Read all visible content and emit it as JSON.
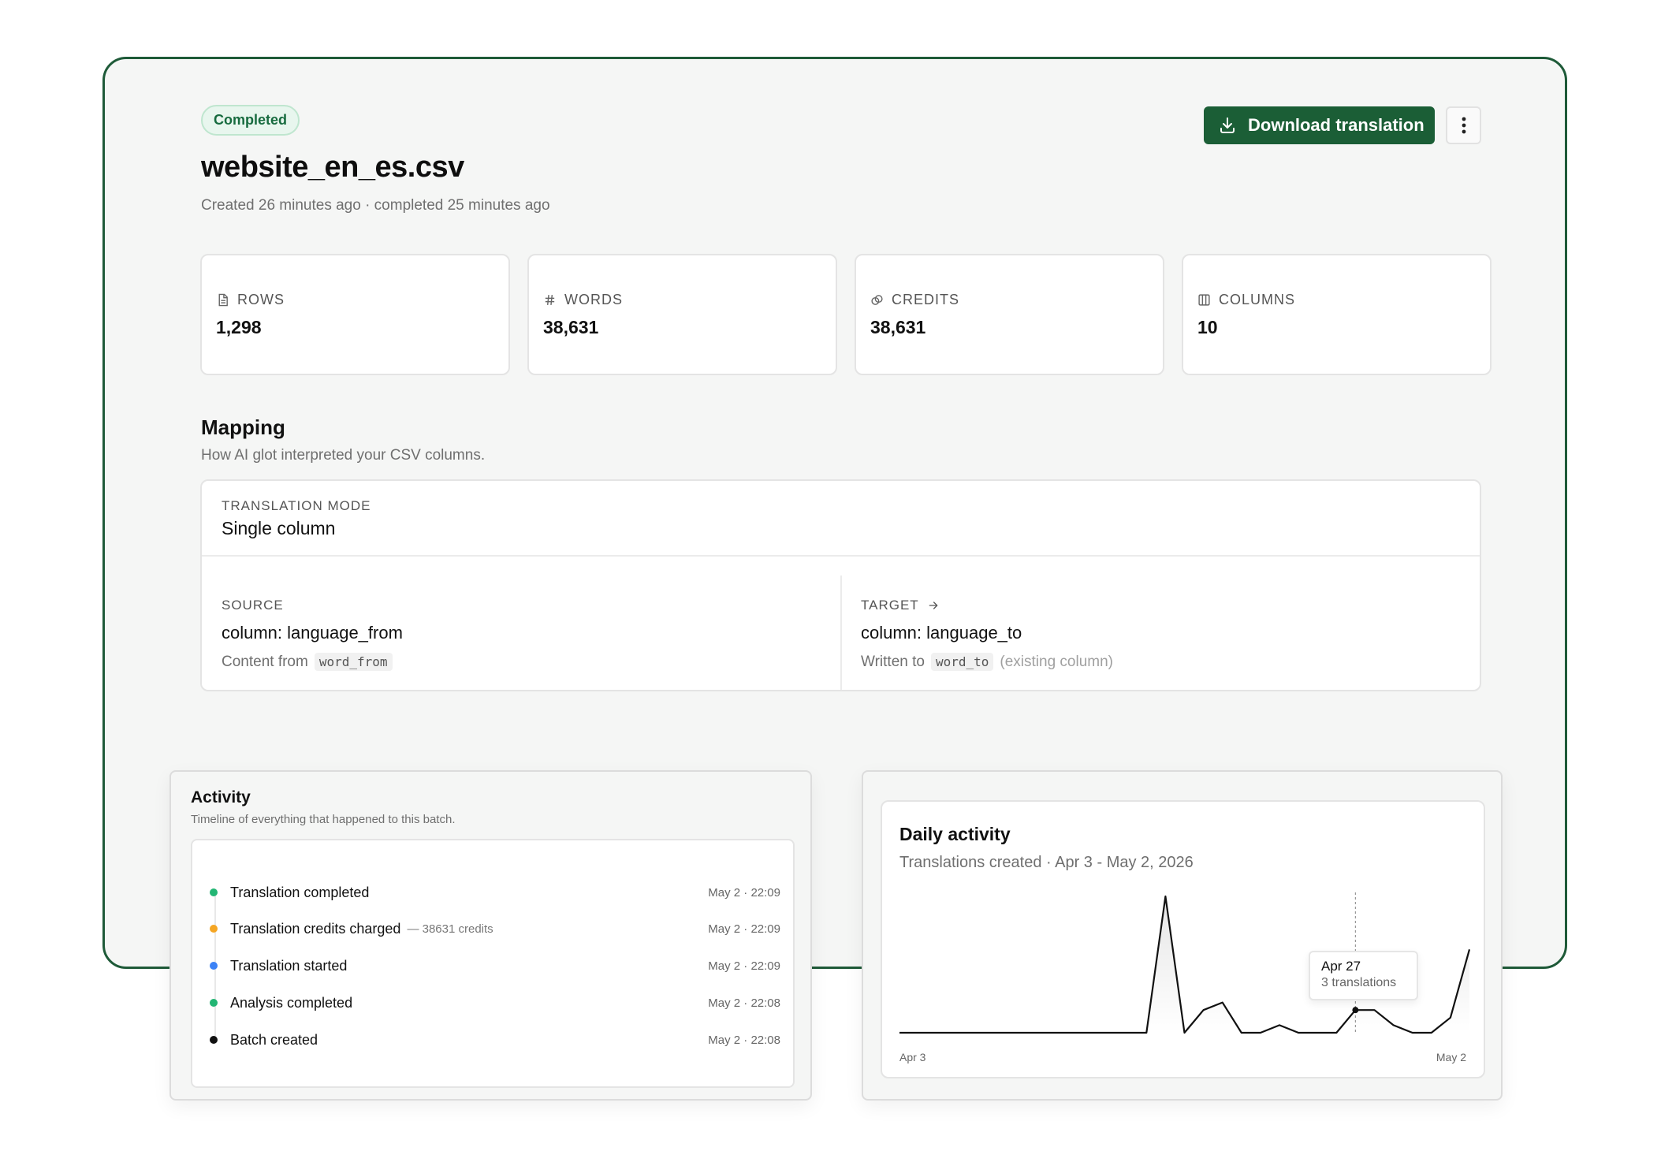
{
  "batch": {
    "status": "Completed",
    "filename": "website_en_es.csv",
    "meta": "Created 26 minutes ago · completed 25 minutes ago",
    "download_label": "Download translation"
  },
  "stats": [
    {
      "label": "ROWS",
      "value": "1,298",
      "icon": "file-icon"
    },
    {
      "label": "WORDS",
      "value": "38,631",
      "icon": "hash-icon"
    },
    {
      "label": "CREDITS",
      "value": "38,631",
      "icon": "coins-icon"
    },
    {
      "label": "COLUMNS",
      "value": "10",
      "icon": "columns-icon"
    }
  ],
  "mapping": {
    "title": "Mapping",
    "subtitle": "How AI glot interpreted your CSV columns.",
    "mode_label": "TRANSLATION MODE",
    "mode_value": "Single column",
    "source_label": "SOURCE",
    "source_value": "column: language_from",
    "source_note_prefix": "Content from",
    "source_code": "word_from",
    "target_label": "TARGET",
    "target_value": "column: language_to",
    "target_note_prefix": "Written to",
    "target_code": "word_to",
    "target_note_suffix": "(existing column)"
  },
  "activity": {
    "title": "Activity",
    "subtitle": "Timeline of everything that happened to this batch.",
    "events": [
      {
        "label": "Translation completed",
        "extra": "",
        "time": "May 2 · 22:09",
        "color": "#22b573"
      },
      {
        "label": "Translation credits charged",
        "extra": "— 38631 credits",
        "time": "May 2 · 22:09",
        "color": "#f5a623"
      },
      {
        "label": "Translation started",
        "extra": "",
        "time": "May 2 · 22:09",
        "color": "#3b82f6"
      },
      {
        "label": "Analysis completed",
        "extra": "",
        "time": "May 2 · 22:08",
        "color": "#22b573"
      },
      {
        "label": "Batch created",
        "extra": "",
        "time": "May 2 · 22:08",
        "color": "#111111"
      }
    ]
  },
  "chart_data": {
    "type": "line",
    "title": "Daily activity",
    "subtitle": "Translations created · Apr 3 - May 2, 2026",
    "x_start_label": "Apr 3",
    "x_end_label": "May 2",
    "x": [
      "Apr 3",
      "Apr 4",
      "Apr 5",
      "Apr 6",
      "Apr 7",
      "Apr 8",
      "Apr 9",
      "Apr 10",
      "Apr 11",
      "Apr 12",
      "Apr 13",
      "Apr 14",
      "Apr 15",
      "Apr 16",
      "Apr 17",
      "Apr 18",
      "Apr 19",
      "Apr 20",
      "Apr 21",
      "Apr 22",
      "Apr 23",
      "Apr 24",
      "Apr 25",
      "Apr 26",
      "Apr 27",
      "Apr 28",
      "Apr 29",
      "Apr 30",
      "May 1",
      "May 2"
    ],
    "values": [
      0,
      0,
      0,
      0,
      0,
      0,
      0,
      0,
      0,
      0,
      0,
      0,
      0,
      0,
      18,
      0,
      3,
      4,
      0,
      0,
      1,
      0,
      0,
      0,
      3,
      3,
      1,
      0,
      0,
      2,
      11
    ],
    "ylim": [
      0,
      18
    ],
    "tooltip": {
      "date": "Apr 27",
      "text": "3 translations",
      "index": 24
    },
    "grid": false,
    "line_color": "#111111"
  }
}
